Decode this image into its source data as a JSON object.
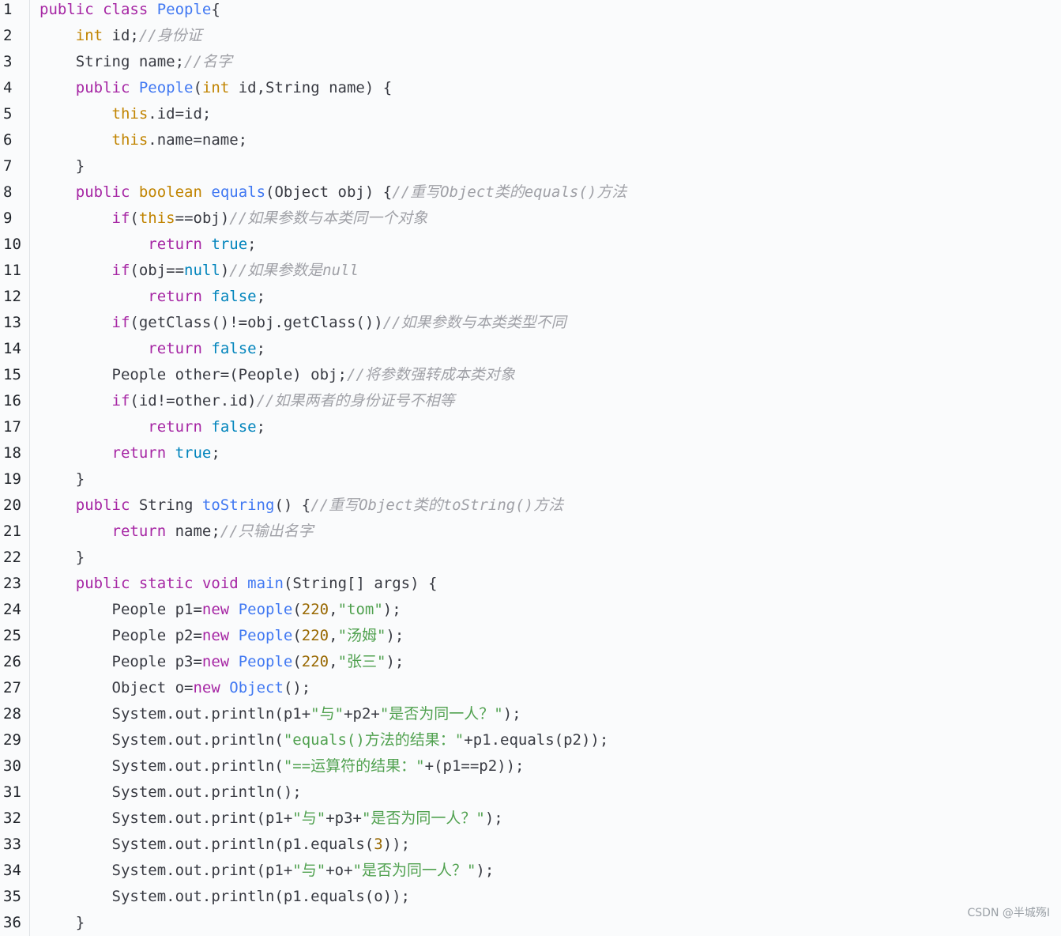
{
  "code_lines": [
    {
      "n": "1",
      "tokens": [
        [
          "public class ",
          "keyword"
        ],
        [
          "People",
          "title"
        ],
        [
          "{",
          "plain"
        ]
      ]
    },
    {
      "n": "2",
      "tokens": [
        [
          "    ",
          "plain"
        ],
        [
          "int",
          "type"
        ],
        [
          " id;",
          "plain"
        ],
        [
          "//身份证",
          "comment"
        ]
      ]
    },
    {
      "n": "3",
      "tokens": [
        [
          "    String name;",
          "plain"
        ],
        [
          "//名字",
          "comment"
        ]
      ]
    },
    {
      "n": "4",
      "tokens": [
        [
          "    ",
          "plain"
        ],
        [
          "public",
          "keyword"
        ],
        [
          " ",
          "plain"
        ],
        [
          "People",
          "title"
        ],
        [
          "(",
          "plain"
        ],
        [
          "int",
          "type"
        ],
        [
          " id,String name) {",
          "plain"
        ]
      ]
    },
    {
      "n": "5",
      "tokens": [
        [
          "        ",
          "plain"
        ],
        [
          "this",
          "this"
        ],
        [
          ".id=id;",
          "plain"
        ]
      ]
    },
    {
      "n": "6",
      "tokens": [
        [
          "        ",
          "plain"
        ],
        [
          "this",
          "this"
        ],
        [
          ".name=name;",
          "plain"
        ]
      ]
    },
    {
      "n": "7",
      "tokens": [
        [
          "    }",
          "plain"
        ]
      ]
    },
    {
      "n": "8",
      "tokens": [
        [
          "    ",
          "plain"
        ],
        [
          "public",
          "keyword"
        ],
        [
          " ",
          "plain"
        ],
        [
          "boolean",
          "type"
        ],
        [
          " ",
          "plain"
        ],
        [
          "equals",
          "title"
        ],
        [
          "(Object obj) {",
          "plain"
        ],
        [
          "//重写Object类的equals()方法",
          "comment"
        ]
      ]
    },
    {
      "n": "9",
      "tokens": [
        [
          "        ",
          "plain"
        ],
        [
          "if",
          "keyword"
        ],
        [
          "(",
          "plain"
        ],
        [
          "this",
          "this"
        ],
        [
          "==obj)",
          "plain"
        ],
        [
          "//如果参数与本类同一个对象",
          "comment"
        ]
      ]
    },
    {
      "n": "10",
      "tokens": [
        [
          "            ",
          "plain"
        ],
        [
          "return",
          "keyword"
        ],
        [
          " ",
          "plain"
        ],
        [
          "true",
          "literal"
        ],
        [
          ";",
          "plain"
        ]
      ]
    },
    {
      "n": "11",
      "tokens": [
        [
          "        ",
          "plain"
        ],
        [
          "if",
          "keyword"
        ],
        [
          "(obj==",
          "plain"
        ],
        [
          "null",
          "literal"
        ],
        [
          ")",
          "plain"
        ],
        [
          "//如果参数是null",
          "comment"
        ]
      ]
    },
    {
      "n": "12",
      "tokens": [
        [
          "            ",
          "plain"
        ],
        [
          "return",
          "keyword"
        ],
        [
          " ",
          "plain"
        ],
        [
          "false",
          "literal"
        ],
        [
          ";",
          "plain"
        ]
      ]
    },
    {
      "n": "13",
      "tokens": [
        [
          "        ",
          "plain"
        ],
        [
          "if",
          "keyword"
        ],
        [
          "(getClass()!=obj.getClass())",
          "plain"
        ],
        [
          "//如果参数与本类类型不同",
          "comment"
        ]
      ]
    },
    {
      "n": "14",
      "tokens": [
        [
          "            ",
          "plain"
        ],
        [
          "return",
          "keyword"
        ],
        [
          " ",
          "plain"
        ],
        [
          "false",
          "literal"
        ],
        [
          ";",
          "plain"
        ]
      ]
    },
    {
      "n": "15",
      "tokens": [
        [
          "        People other=(People) obj;",
          "plain"
        ],
        [
          "//将参数强转成本类对象",
          "comment"
        ]
      ]
    },
    {
      "n": "16",
      "tokens": [
        [
          "        ",
          "plain"
        ],
        [
          "if",
          "keyword"
        ],
        [
          "(id!=other.id)",
          "plain"
        ],
        [
          "//如果两者的身份证号不相等",
          "comment"
        ]
      ]
    },
    {
      "n": "17",
      "tokens": [
        [
          "            ",
          "plain"
        ],
        [
          "return",
          "keyword"
        ],
        [
          " ",
          "plain"
        ],
        [
          "false",
          "literal"
        ],
        [
          ";",
          "plain"
        ]
      ]
    },
    {
      "n": "18",
      "tokens": [
        [
          "        ",
          "plain"
        ],
        [
          "return",
          "keyword"
        ],
        [
          " ",
          "plain"
        ],
        [
          "true",
          "literal"
        ],
        [
          ";",
          "plain"
        ]
      ]
    },
    {
      "n": "19",
      "tokens": [
        [
          "    }",
          "plain"
        ]
      ]
    },
    {
      "n": "20",
      "tokens": [
        [
          "    ",
          "plain"
        ],
        [
          "public",
          "keyword"
        ],
        [
          " String ",
          "plain"
        ],
        [
          "toString",
          "title"
        ],
        [
          "() {",
          "plain"
        ],
        [
          "//重写Object类的toString()方法",
          "comment"
        ]
      ]
    },
    {
      "n": "21",
      "tokens": [
        [
          "        ",
          "plain"
        ],
        [
          "return",
          "keyword"
        ],
        [
          " name;",
          "plain"
        ],
        [
          "//只输出名字",
          "comment"
        ]
      ]
    },
    {
      "n": "22",
      "tokens": [
        [
          "    }",
          "plain"
        ]
      ]
    },
    {
      "n": "23",
      "tokens": [
        [
          "    ",
          "plain"
        ],
        [
          "public",
          "keyword"
        ],
        [
          " ",
          "plain"
        ],
        [
          "static",
          "keyword"
        ],
        [
          " ",
          "plain"
        ],
        [
          "void",
          "keyword"
        ],
        [
          " ",
          "plain"
        ],
        [
          "main",
          "title"
        ],
        [
          "(String[] args) {",
          "plain"
        ]
      ]
    },
    {
      "n": "24",
      "tokens": [
        [
          "        People p1=",
          "plain"
        ],
        [
          "new",
          "keyword"
        ],
        [
          " ",
          "plain"
        ],
        [
          "People",
          "title"
        ],
        [
          "(",
          "plain"
        ],
        [
          "220",
          "number"
        ],
        [
          ",",
          "plain"
        ],
        [
          "\"tom\"",
          "string"
        ],
        [
          ");",
          "plain"
        ]
      ]
    },
    {
      "n": "25",
      "tokens": [
        [
          "        People p2=",
          "plain"
        ],
        [
          "new",
          "keyword"
        ],
        [
          " ",
          "plain"
        ],
        [
          "People",
          "title"
        ],
        [
          "(",
          "plain"
        ],
        [
          "220",
          "number"
        ],
        [
          ",",
          "plain"
        ],
        [
          "\"汤姆\"",
          "string"
        ],
        [
          ");",
          "plain"
        ]
      ]
    },
    {
      "n": "26",
      "tokens": [
        [
          "        People p3=",
          "plain"
        ],
        [
          "new",
          "keyword"
        ],
        [
          " ",
          "plain"
        ],
        [
          "People",
          "title"
        ],
        [
          "(",
          "plain"
        ],
        [
          "220",
          "number"
        ],
        [
          ",",
          "plain"
        ],
        [
          "\"张三\"",
          "string"
        ],
        [
          ");",
          "plain"
        ]
      ]
    },
    {
      "n": "27",
      "tokens": [
        [
          "        Object o=",
          "plain"
        ],
        [
          "new",
          "keyword"
        ],
        [
          " ",
          "plain"
        ],
        [
          "Object",
          "title"
        ],
        [
          "();",
          "plain"
        ]
      ]
    },
    {
      "n": "28",
      "tokens": [
        [
          "        System.out.println(p1+",
          "plain"
        ],
        [
          "\"与\"",
          "string"
        ],
        [
          "+p2+",
          "plain"
        ],
        [
          "\"是否为同一人？\"",
          "string"
        ],
        [
          ");",
          "plain"
        ]
      ]
    },
    {
      "n": "29",
      "tokens": [
        [
          "        System.out.println(",
          "plain"
        ],
        [
          "\"equals()方法的结果：\"",
          "string"
        ],
        [
          "+p1.equals(p2));",
          "plain"
        ]
      ]
    },
    {
      "n": "30",
      "tokens": [
        [
          "        System.out.println(",
          "plain"
        ],
        [
          "\"==运算符的结果：\"",
          "string"
        ],
        [
          "+(p1==p2));",
          "plain"
        ]
      ]
    },
    {
      "n": "31",
      "tokens": [
        [
          "        System.out.println();",
          "plain"
        ]
      ]
    },
    {
      "n": "32",
      "tokens": [
        [
          "        System.out.print(p1+",
          "plain"
        ],
        [
          "\"与\"",
          "string"
        ],
        [
          "+p3+",
          "plain"
        ],
        [
          "\"是否为同一人？\"",
          "string"
        ],
        [
          ");",
          "plain"
        ]
      ]
    },
    {
      "n": "33",
      "tokens": [
        [
          "        System.out.println(p1.equals(",
          "plain"
        ],
        [
          "3",
          "number"
        ],
        [
          "));",
          "plain"
        ]
      ]
    },
    {
      "n": "34",
      "tokens": [
        [
          "        System.out.print(p1+",
          "plain"
        ],
        [
          "\"与\"",
          "string"
        ],
        [
          "+o+",
          "plain"
        ],
        [
          "\"是否为同一人？\"",
          "string"
        ],
        [
          ");",
          "plain"
        ]
      ]
    },
    {
      "n": "35",
      "tokens": [
        [
          "        System.out.println(p1.equals(o));",
          "plain"
        ]
      ]
    },
    {
      "n": "36",
      "tokens": [
        [
          "    }",
          "plain"
        ]
      ]
    }
  ],
  "watermark": "CSDN @半城殇I"
}
